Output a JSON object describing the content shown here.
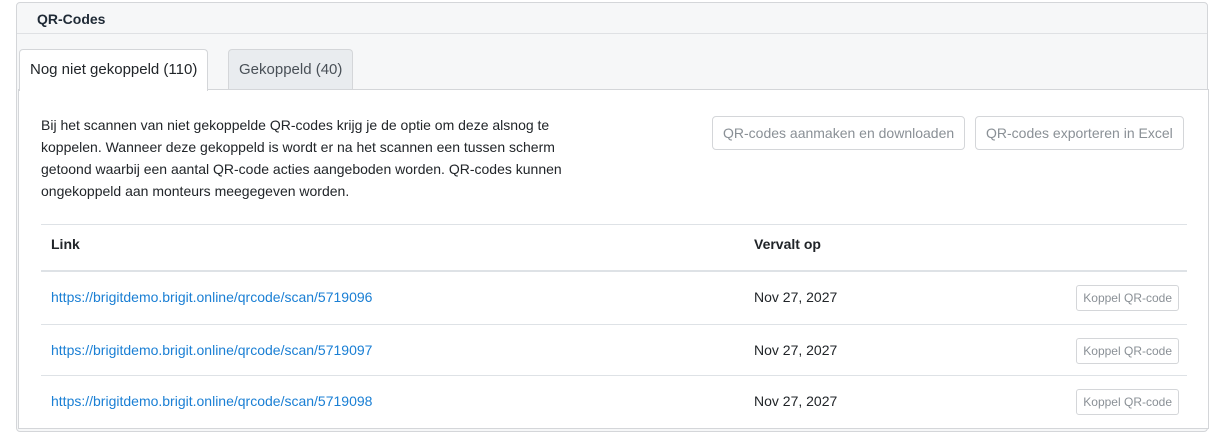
{
  "panel": {
    "title": "QR-Codes"
  },
  "tabs": [
    {
      "label": "Nog niet gekoppeld (110)",
      "active": true
    },
    {
      "label": "Gekoppeld (40)",
      "active": false
    }
  ],
  "description": "Bij het scannen van niet gekoppelde QR-codes krijg je de optie om deze alsnog te koppelen. Wanneer deze gekoppeld is wordt er na het scannen een tussen scherm getoond waarbij een aantal QR-code acties aangeboden worden. QR-codes kunnen ongekoppeld aan monteurs meegegeven worden.",
  "actions": {
    "create_download": "QR-codes aanmaken en downloaden",
    "export_excel": "QR-codes exporteren in Excel"
  },
  "table": {
    "headers": {
      "link": "Link",
      "expires": "Vervalt op"
    },
    "rows": [
      {
        "link": "https://brigitdemo.brigit.online/qrcode/scan/5719096",
        "expires": "Nov 27, 2027",
        "action": "Koppel QR-code"
      },
      {
        "link": "https://brigitdemo.brigit.online/qrcode/scan/5719097",
        "expires": "Nov 27, 2027",
        "action": "Koppel QR-code"
      },
      {
        "link": "https://brigitdemo.brigit.online/qrcode/scan/5719098",
        "expires": "Nov 27, 2027",
        "action": "Koppel QR-code"
      }
    ]
  },
  "colors": {
    "link": "#1a7fd4",
    "border": "#d4d6d9",
    "panel_bg": "#f6f7f8"
  }
}
